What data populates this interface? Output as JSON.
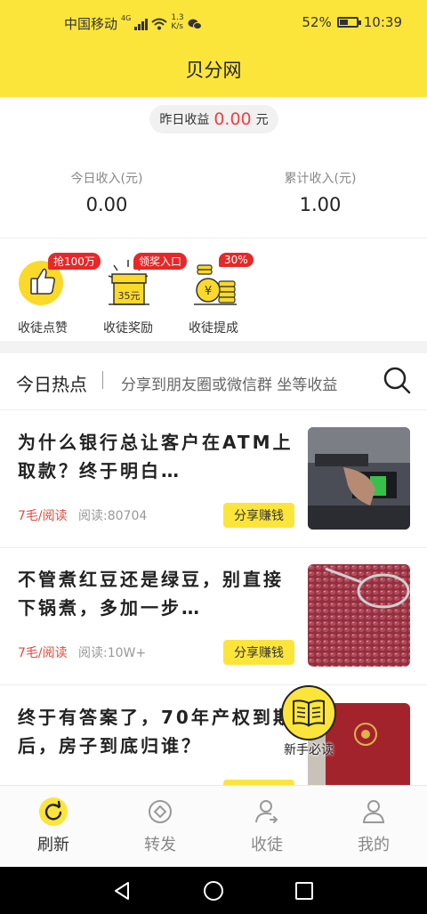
{
  "status_bar": {
    "carrier": "中国移动",
    "network": "4G",
    "speed_top": "1.3",
    "speed_bottom": "K/s",
    "battery_pct": "52%",
    "battery_level": 0.52,
    "time": "10:39"
  },
  "header": {
    "title": "贝分网"
  },
  "earnings": {
    "yesterday_label": "昨日收益",
    "yesterday_value": "0.00",
    "yesterday_unit": "元",
    "today_label": "今日收入(元)",
    "today_value": "0.00",
    "total_label": "累计收入(元)",
    "total_value": "1.00"
  },
  "features": [
    {
      "label": "收徒点赞",
      "badge": "抢100万",
      "icon": "thumbs-up-icon"
    },
    {
      "label": "收徒奖励",
      "badge": "领奖入口",
      "icon": "gift-box-icon",
      "gift_text": "35元"
    },
    {
      "label": "收徒提成",
      "badge": "30%",
      "icon": "coins-icon"
    }
  ],
  "hot": {
    "title": "今日热点",
    "subtitle": "分享到朋友圈或微信群 坐等收益"
  },
  "articles": [
    {
      "title": "为什么银行总让客户在ATM上取款？终于明白…",
      "price": "7毛/阅读",
      "reads": "阅读:80704",
      "share": "分享赚钱",
      "thumb": "atm-photo"
    },
    {
      "title": "不管煮红豆还是绿豆，别直接下锅煮，多加一步…",
      "price": "7毛/阅读",
      "reads": "阅读:10W+",
      "share": "分享赚钱",
      "thumb": "red-beans-photo"
    },
    {
      "title": "终于有答案了，70年产权到期后，房子到底归谁？",
      "price": "",
      "reads": "",
      "share": "",
      "thumb": "property-certificate-photo"
    }
  ],
  "floating_button": {
    "label": "新手必读"
  },
  "tabbar": [
    {
      "label": "刷新",
      "icon": "refresh-icon",
      "active": true
    },
    {
      "label": "转发",
      "icon": "forward-icon",
      "active": false
    },
    {
      "label": "收徒",
      "icon": "add-apprentice-icon",
      "active": false
    },
    {
      "label": "我的",
      "icon": "profile-icon",
      "active": false
    }
  ],
  "colors": {
    "brand_yellow": "#FBE53B",
    "accent_red": "#E62828",
    "price_red": "#E04B3C"
  }
}
